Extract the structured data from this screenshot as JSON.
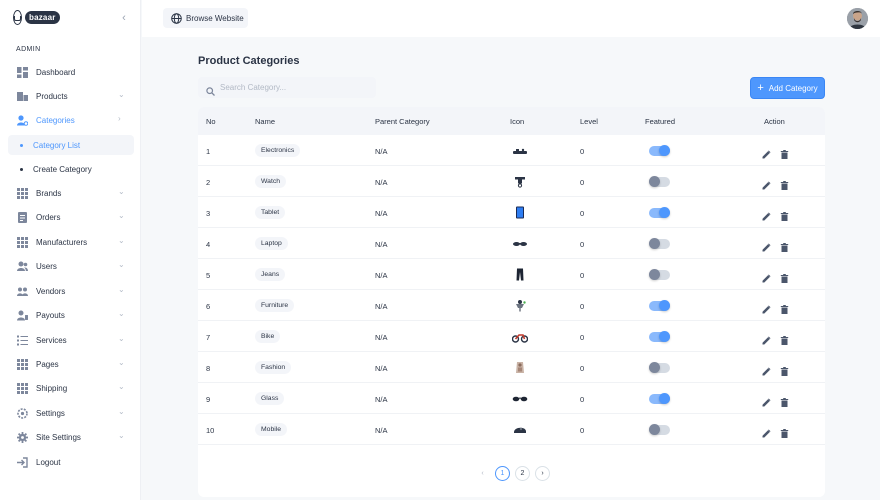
{
  "sidebar": {
    "logo_text": "bazaar",
    "section_label": "ADMIN",
    "items": [
      {
        "label": "Dashboard",
        "icon": "dashboard-icon",
        "has_chevron": false
      },
      {
        "label": "Products",
        "icon": "products-icon",
        "has_chevron": true
      },
      {
        "label": "Categories",
        "icon": "categories-icon",
        "has_chevron": true,
        "active": true
      },
      {
        "label": "Brands",
        "icon": "grid-icon",
        "has_chevron": true
      },
      {
        "label": "Orders",
        "icon": "orders-icon",
        "has_chevron": true
      },
      {
        "label": "Manufacturers",
        "icon": "grid-icon",
        "has_chevron": true
      },
      {
        "label": "Users",
        "icon": "users-icon",
        "has_chevron": true
      },
      {
        "label": "Vendors",
        "icon": "vendors-icon",
        "has_chevron": true
      },
      {
        "label": "Payouts",
        "icon": "payouts-icon",
        "has_chevron": true
      },
      {
        "label": "Services",
        "icon": "services-icon",
        "has_chevron": true
      },
      {
        "label": "Pages",
        "icon": "grid-icon",
        "has_chevron": true
      },
      {
        "label": "Shipping",
        "icon": "grid-icon",
        "has_chevron": true
      },
      {
        "label": "Settings",
        "icon": "settings-icon",
        "has_chevron": true
      },
      {
        "label": "Site Settings",
        "icon": "gear-icon",
        "has_chevron": true
      },
      {
        "label": "Logout",
        "icon": "logout-icon",
        "has_chevron": false
      }
    ],
    "sub_items": [
      {
        "label": "Category List",
        "active": true
      },
      {
        "label": "Create Category",
        "active": false
      }
    ]
  },
  "header": {
    "browse_label": "Browse Website"
  },
  "main": {
    "title": "Product Categories",
    "search_placeholder": "Search Category...",
    "add_button_label": "Add Category",
    "columns": [
      "No",
      "Name",
      "Parent Category",
      "Icon",
      "Level",
      "Featured",
      "Action"
    ],
    "rows": [
      {
        "no": "1",
        "name": "Electronics",
        "parent": "N/A",
        "icon": "electronics-icon",
        "level": "0",
        "featured": true
      },
      {
        "no": "2",
        "name": "Watch",
        "parent": "N/A",
        "icon": "watch-icon",
        "level": "0",
        "featured": false
      },
      {
        "no": "3",
        "name": "Tablet",
        "parent": "N/A",
        "icon": "tablet-icon",
        "level": "0",
        "featured": true
      },
      {
        "no": "4",
        "name": "Laptop",
        "parent": "N/A",
        "icon": "laptop-icon",
        "level": "0",
        "featured": false
      },
      {
        "no": "5",
        "name": "Jeans",
        "parent": "N/A",
        "icon": "jeans-icon",
        "level": "0",
        "featured": false
      },
      {
        "no": "6",
        "name": "Furniture",
        "parent": "N/A",
        "icon": "furniture-icon",
        "level": "0",
        "featured": true
      },
      {
        "no": "7",
        "name": "Bike",
        "parent": "N/A",
        "icon": "bike-icon",
        "level": "0",
        "featured": true
      },
      {
        "no": "8",
        "name": "Fashion",
        "parent": "N/A",
        "icon": "fashion-icon",
        "level": "0",
        "featured": false
      },
      {
        "no": "9",
        "name": "Glass",
        "parent": "N/A",
        "icon": "glass-icon",
        "level": "0",
        "featured": true
      },
      {
        "no": "10",
        "name": "Mobile",
        "parent": "N/A",
        "icon": "mobile-icon",
        "level": "0",
        "featured": false
      }
    ],
    "pagination": {
      "pages": [
        "1",
        "2"
      ],
      "current": "1",
      "prev": "‹",
      "next": "›"
    }
  },
  "colors": {
    "accent": "#4e97fd",
    "text": "#2b3445",
    "background": "#f6f8fa",
    "toggle_on_track": "#8ab9fc",
    "toggle_off_knob": "#7d879c"
  }
}
